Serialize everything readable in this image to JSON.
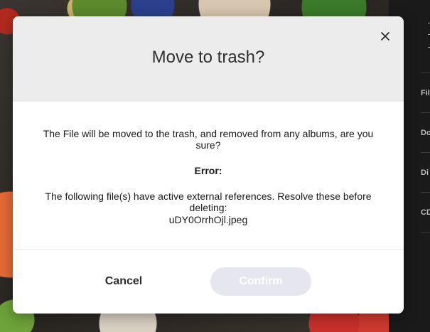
{
  "dialog": {
    "title": "Move to trash?",
    "message": "The File will be moved to the trash, and removed from any albums, are you sure?",
    "error_label": "Error:",
    "error_message": "The following file(s) have active external references. Resolve these before deleting:",
    "file_name": "uDY0OrrhOjl.jpeg",
    "cancel_label": "Cancel",
    "confirm_label": "Confirm"
  },
  "side_panel": {
    "items": [
      "Fil",
      "Do",
      "Di",
      "CD"
    ]
  },
  "icons": {
    "close": "close-icon"
  },
  "colors": {
    "header_bg": "#ececec",
    "confirm_disabled_bg": "#e6e6f0",
    "side_panel_bg": "#1a1a1a"
  }
}
